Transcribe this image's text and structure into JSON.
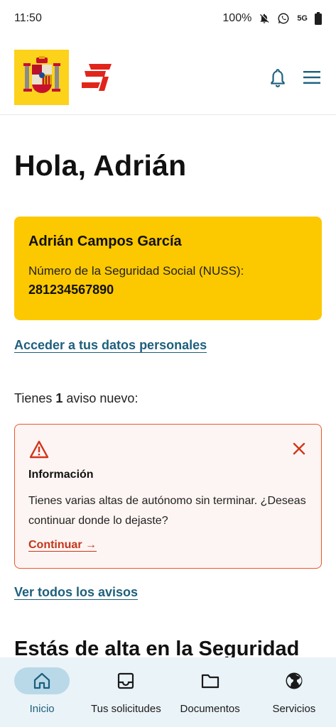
{
  "status_bar": {
    "time": "11:50",
    "battery": "100%",
    "network": "5G",
    "icons": [
      "bell-off-icon",
      "whatsapp-icon",
      "battery-icon"
    ]
  },
  "header": {
    "icons": [
      "coat-of-arms-logo",
      "seguridad-social-logo",
      "bell-icon",
      "hamburger-menu-icon"
    ]
  },
  "greeting": "Hola, Adrián",
  "user_card": {
    "name": "Adrián Campos García",
    "nuss_label": "Número de la Seguridad Social (NUSS):",
    "nuss_value": "281234567890"
  },
  "links": {
    "personal_data": "Acceder a tus datos personales",
    "all_notices": "Ver todos los avisos"
  },
  "notices": {
    "prefix": "Tienes ",
    "count": "1",
    "suffix": " aviso nuevo:"
  },
  "alert": {
    "title": "Información",
    "text": "Tienes varias altas de autónomo sin terminar. ¿Deseas continuar donde lo dejaste?",
    "action": "Continuar →",
    "icons": [
      "warning-icon",
      "close-icon"
    ]
  },
  "section_heading": "Estás de alta en la Seguridad",
  "bottom_nav": [
    {
      "label": "Inicio",
      "icon": "home-icon",
      "active": true
    },
    {
      "label": "Tus solicitudes",
      "icon": "inbox-icon",
      "active": false
    },
    {
      "label": "Documentos",
      "icon": "folder-icon",
      "active": false
    },
    {
      "label": "Servicios",
      "icon": "globe-icon",
      "active": false
    }
  ],
  "colors": {
    "accent": "#1d5f7d",
    "card_yellow": "#fcc800",
    "alert_red": "#e8562a",
    "nav_bg": "#eaf3f8",
    "nav_active": "#b9d9e8"
  }
}
